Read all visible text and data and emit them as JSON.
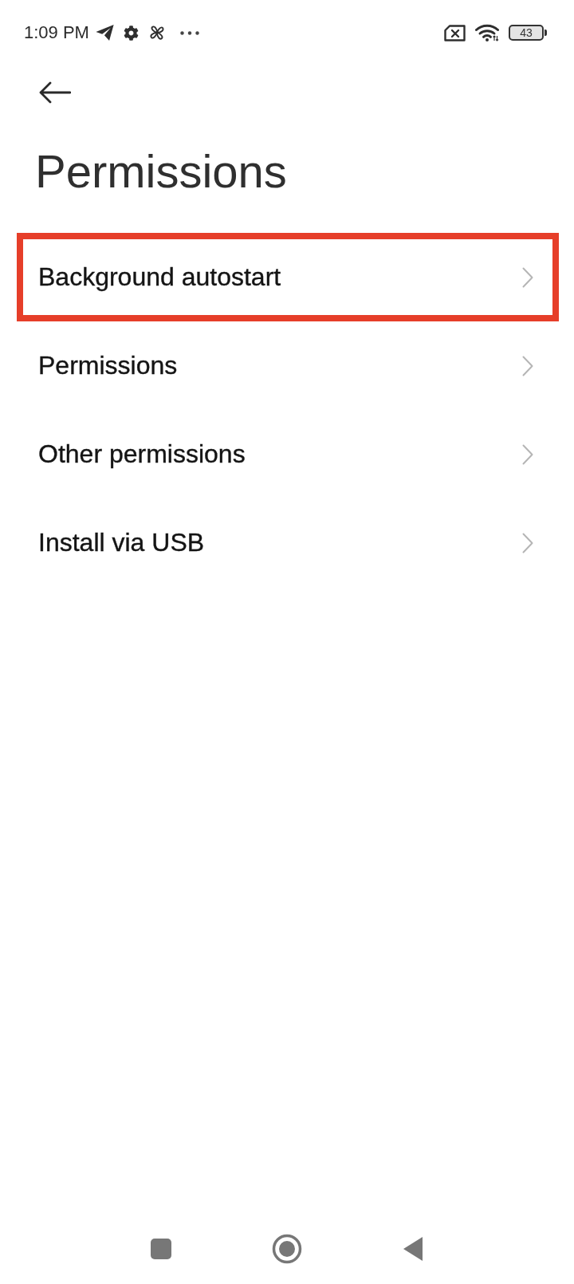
{
  "status_bar": {
    "time": "1:09 PM",
    "battery": "43"
  },
  "title": "Permissions",
  "items": [
    {
      "label": "Background autostart",
      "highlighted": true
    },
    {
      "label": "Permissions",
      "highlighted": false
    },
    {
      "label": "Other permissions",
      "highlighted": false
    },
    {
      "label": "Install via USB",
      "highlighted": false
    }
  ]
}
